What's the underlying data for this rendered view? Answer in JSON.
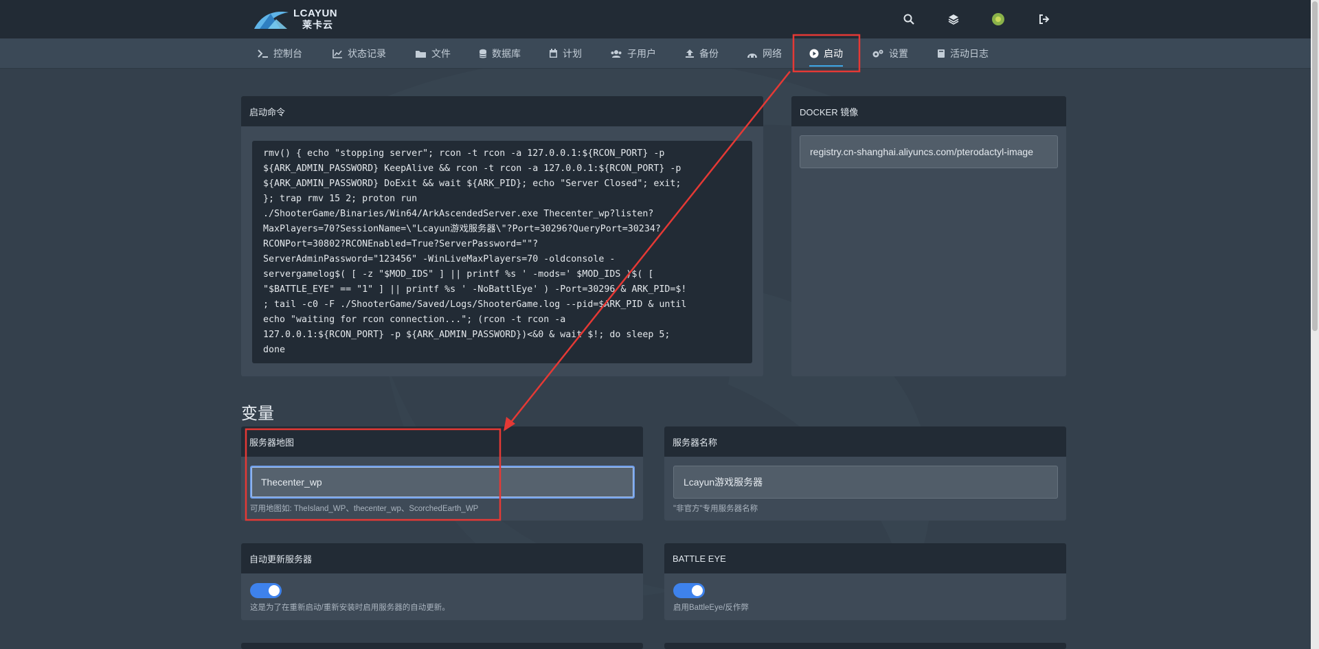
{
  "brand": {
    "name": "LCAYUN",
    "sub": "莱卡云"
  },
  "header_icons": [
    "search-icon",
    "layers-icon",
    "avatar",
    "logout-icon"
  ],
  "nav": {
    "items": [
      {
        "label": "控制台",
        "icon": "terminal-icon"
      },
      {
        "label": "状态记录",
        "icon": "chart-line-icon"
      },
      {
        "label": "文件",
        "icon": "folder-icon"
      },
      {
        "label": "数据库",
        "icon": "database-icon"
      },
      {
        "label": "计划",
        "icon": "calendar-icon"
      },
      {
        "label": "子用户",
        "icon": "users-icon"
      },
      {
        "label": "备份",
        "icon": "upload-icon"
      },
      {
        "label": "网络",
        "icon": "network-icon"
      },
      {
        "label": "启动",
        "icon": "play-circle-icon"
      },
      {
        "label": "设置",
        "icon": "gears-icon"
      },
      {
        "label": "活动日志",
        "icon": "book-icon"
      }
    ],
    "active": "启动"
  },
  "startup": {
    "title": "启动命令",
    "command": "rmv() { echo \"stopping server\"; rcon -t rcon -a 127.0.0.1:${RCON_PORT} -p\n${ARK_ADMIN_PASSWORD} KeepAlive && rcon -t rcon -a 127.0.0.1:${RCON_PORT} -p\n${ARK_ADMIN_PASSWORD} DoExit && wait ${ARK_PID}; echo \"Server Closed\"; exit;\n}; trap rmv 15 2; proton run\n./ShooterGame/Binaries/Win64/ArkAscendedServer.exe Thecenter_wp?listen?\nMaxPlayers=70?SessionName=\\\"Lcayun游戏服务器\\\"?Port=30296?QueryPort=30234?\nRCONPort=30802?RCONEnabled=True?ServerPassword=\"\"?\nServerAdminPassword=\"123456\" -WinLiveMaxPlayers=70 -oldconsole -\nservergamelog$( [ -z \"$MOD_IDS\" ] || printf %s ' -mods=' $MOD_IDS )$( [\n\"$BATTLE_EYE\" == \"1\" ] || printf %s ' -NoBattlEye' ) -Port=30296 & ARK_PID=$!\n; tail -c0 -F ./ShooterGame/Saved/Logs/ShooterGame.log --pid=$ARK_PID & until\necho \"waiting for rcon connection...\"; (rcon -t rcon -a\n127.0.0.1:${RCON_PORT} -p ${ARK_ADMIN_PASSWORD})<&0 & wait $!; do sleep 5;\ndone"
  },
  "docker": {
    "title": "DOCKER 镜像",
    "value": "registry.cn-shanghai.aliyuncs.com/pterodactyl-image"
  },
  "variables": {
    "title": "变量",
    "server_map": {
      "label": "服务器地图",
      "value": "Thecenter_wp",
      "hint": "可用地图如: TheIsland_WP、thecenter_wp、ScorchedEarth_WP"
    },
    "server_name": {
      "label": "服务器名称",
      "value": "Lcayun游戏服务器",
      "hint": "\"非官方\"专用服务器名称"
    },
    "auto_update": {
      "label": "自动更新服务器",
      "enabled": true,
      "hint": "这是为了在重新启动/重新安装时启用服务器的自动更新。"
    },
    "battle_eye": {
      "label": "BATTLE EYE",
      "enabled": true,
      "hint": "启用BattleEye/反作弊"
    }
  },
  "colors": {
    "accent": "#3fa9e8",
    "annotation": "#e53935",
    "toggle": "#3e82ec"
  }
}
